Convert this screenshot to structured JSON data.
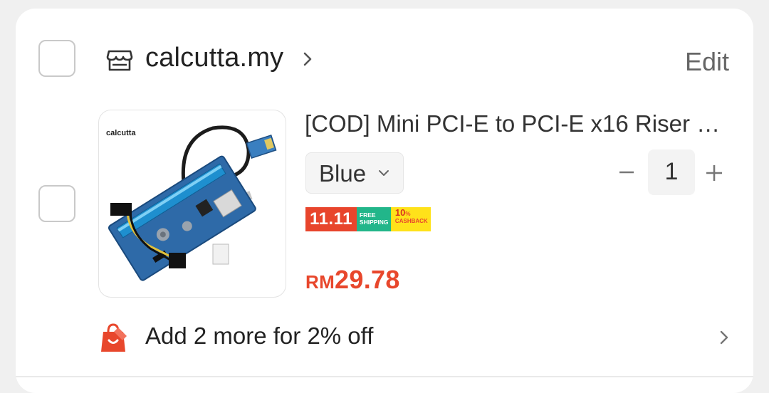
{
  "shop": {
    "name": "calcutta.my",
    "edit_label": "Edit",
    "icon": "store-icon"
  },
  "product": {
    "title": "[COD] Mini PCI-E to PCI-E x16 Riser Ext…",
    "image_brand_text": "calcutta",
    "variant": "Blue",
    "quantity": "1",
    "badges": {
      "sale": "11.11",
      "free_shipping_line1": "FREE",
      "free_shipping_line2": "SHIPPING",
      "cashback_percent": "10",
      "cashback_unit": "%",
      "cashback_label": "CASHBACK"
    },
    "price_currency": "RM",
    "price_value": "29.78"
  },
  "promo": {
    "text": "Add 2 more for 2% off",
    "icon": "shopping-bag-icon"
  },
  "colors": {
    "accent": "#e8472c",
    "free_shipping": "#22b68a",
    "cashback": "#ffe21a"
  }
}
